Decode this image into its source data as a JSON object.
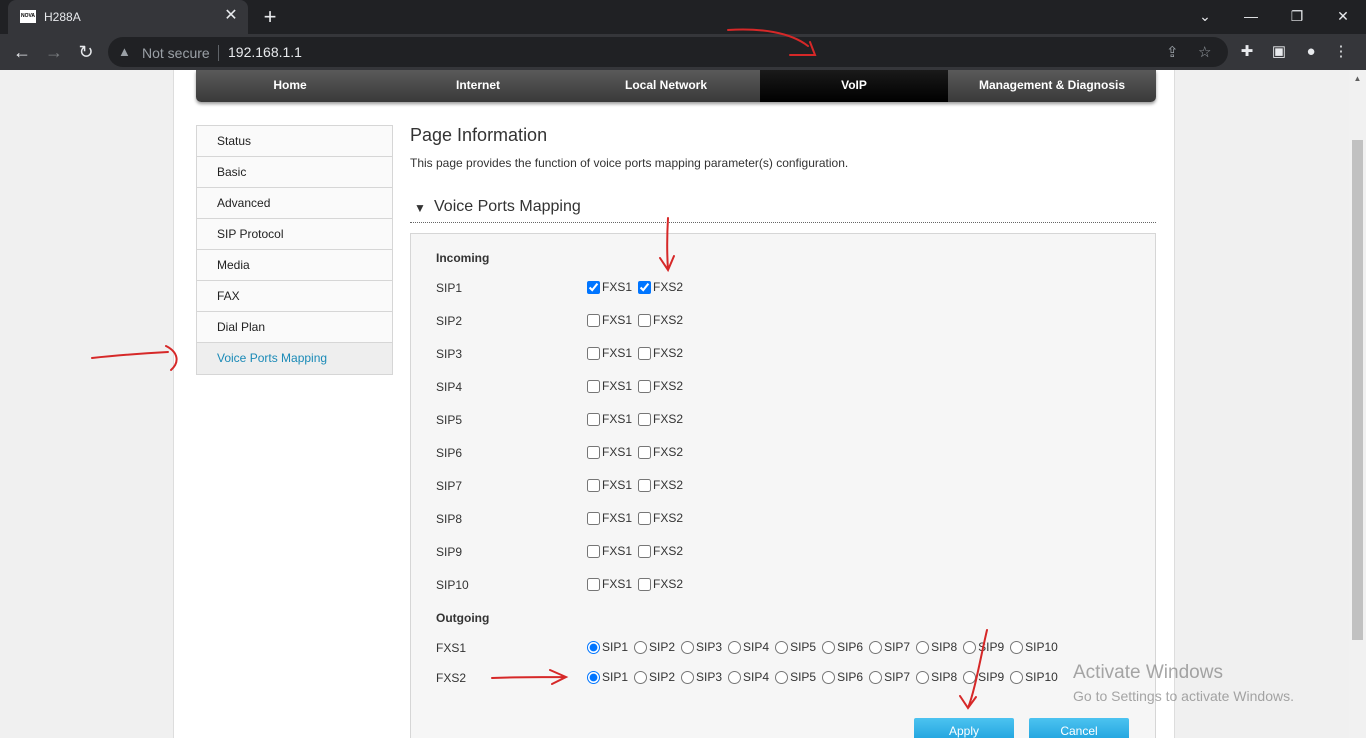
{
  "browser": {
    "tab_title": "H288A",
    "tab_favicon_text": "NOVA",
    "security_label": "Not secure",
    "url": "192.168.1.1"
  },
  "topnav": [
    {
      "label": "Home",
      "active": false
    },
    {
      "label": "Internet",
      "active": false
    },
    {
      "label": "Local Network",
      "active": false
    },
    {
      "label": "VoIP",
      "active": true
    },
    {
      "label": "Management & Diagnosis",
      "active": false
    }
  ],
  "sidemenu": [
    {
      "label": "Status",
      "active": false
    },
    {
      "label": "Basic",
      "active": false
    },
    {
      "label": "Advanced",
      "active": false
    },
    {
      "label": "SIP Protocol",
      "active": false
    },
    {
      "label": "Media",
      "active": false
    },
    {
      "label": "FAX",
      "active": false
    },
    {
      "label": "Dial Plan",
      "active": false
    },
    {
      "label": "Voice Ports Mapping",
      "active": true
    }
  ],
  "content": {
    "title": "Page Information",
    "description": "This page provides the function of voice ports mapping parameter(s) configuration.",
    "section_title": "Voice Ports Mapping"
  },
  "incoming": {
    "label": "Incoming",
    "option_labels": [
      "FXS1",
      "FXS2"
    ],
    "rows": [
      {
        "label": "SIP1",
        "checked": [
          true,
          true
        ]
      },
      {
        "label": "SIP2",
        "checked": [
          false,
          false
        ]
      },
      {
        "label": "SIP3",
        "checked": [
          false,
          false
        ]
      },
      {
        "label": "SIP4",
        "checked": [
          false,
          false
        ]
      },
      {
        "label": "SIP5",
        "checked": [
          false,
          false
        ]
      },
      {
        "label": "SIP6",
        "checked": [
          false,
          false
        ]
      },
      {
        "label": "SIP7",
        "checked": [
          false,
          false
        ]
      },
      {
        "label": "SIP8",
        "checked": [
          false,
          false
        ]
      },
      {
        "label": "SIP9",
        "checked": [
          false,
          false
        ]
      },
      {
        "label": "SIP10",
        "checked": [
          false,
          false
        ]
      }
    ]
  },
  "outgoing": {
    "label": "Outgoing",
    "option_labels": [
      "SIP1",
      "SIP2",
      "SIP3",
      "SIP4",
      "SIP5",
      "SIP6",
      "SIP7",
      "SIP8",
      "SIP9",
      "SIP10"
    ],
    "rows": [
      {
        "label": "FXS1",
        "selected": "SIP1"
      },
      {
        "label": "FXS2",
        "selected": "SIP1"
      }
    ]
  },
  "buttons": {
    "apply": "Apply",
    "cancel": "Cancel"
  },
  "watermark": {
    "line1": "Activate Windows",
    "line2": "Go to Settings to activate Windows."
  },
  "colors": {
    "accent": "#1a8ab7",
    "annotation": "#d62828"
  }
}
